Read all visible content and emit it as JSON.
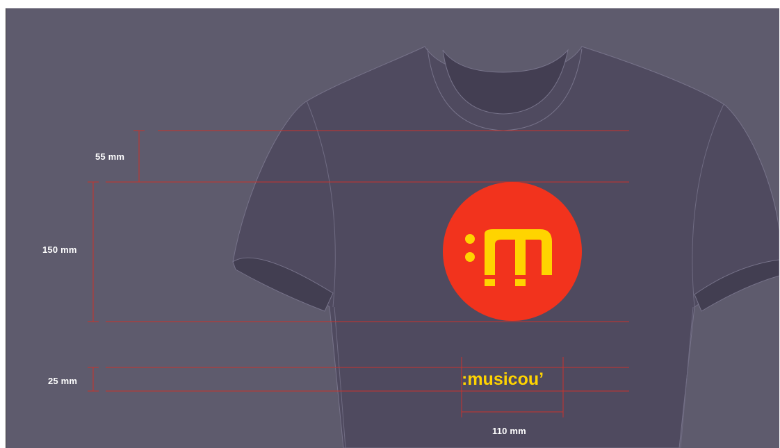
{
  "colors": {
    "background": "#5e5b6d",
    "shirt": "#4f4a5f",
    "shirt_outline": "#77738a",
    "guide_line": "#c8332c",
    "logo_circle": "#f2331d",
    "logo_yellow": "#ffd400"
  },
  "dimensions": {
    "top_offset": "55 mm",
    "logo_height": "150 mm",
    "wordmark_height": "25 mm",
    "wordmark_width": "110 mm"
  },
  "logo": {
    "emblem_text": ":m",
    "wordmark_text": ":musicou’"
  }
}
